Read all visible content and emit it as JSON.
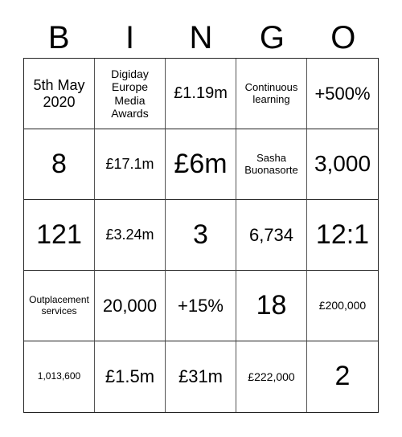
{
  "header": {
    "letters": [
      "B",
      "I",
      "N",
      "G",
      "O"
    ]
  },
  "card": {
    "rows": [
      [
        "5th May 2020",
        "Digiday Europe Media Awards",
        "£1.19m",
        "Continuous learning",
        "+500%"
      ],
      [
        "8",
        "£17.1m",
        "£6m",
        "Sasha Buonasorte",
        "3,000"
      ],
      [
        "121",
        "£3.24m",
        "3",
        "6,734",
        "12:1"
      ],
      [
        "Outplacement services",
        "20,000",
        "+15%",
        "18",
        "£200,000"
      ],
      [
        "1,013,600",
        "£1.5m",
        "£31m",
        "£222,000",
        "2"
      ]
    ]
  }
}
